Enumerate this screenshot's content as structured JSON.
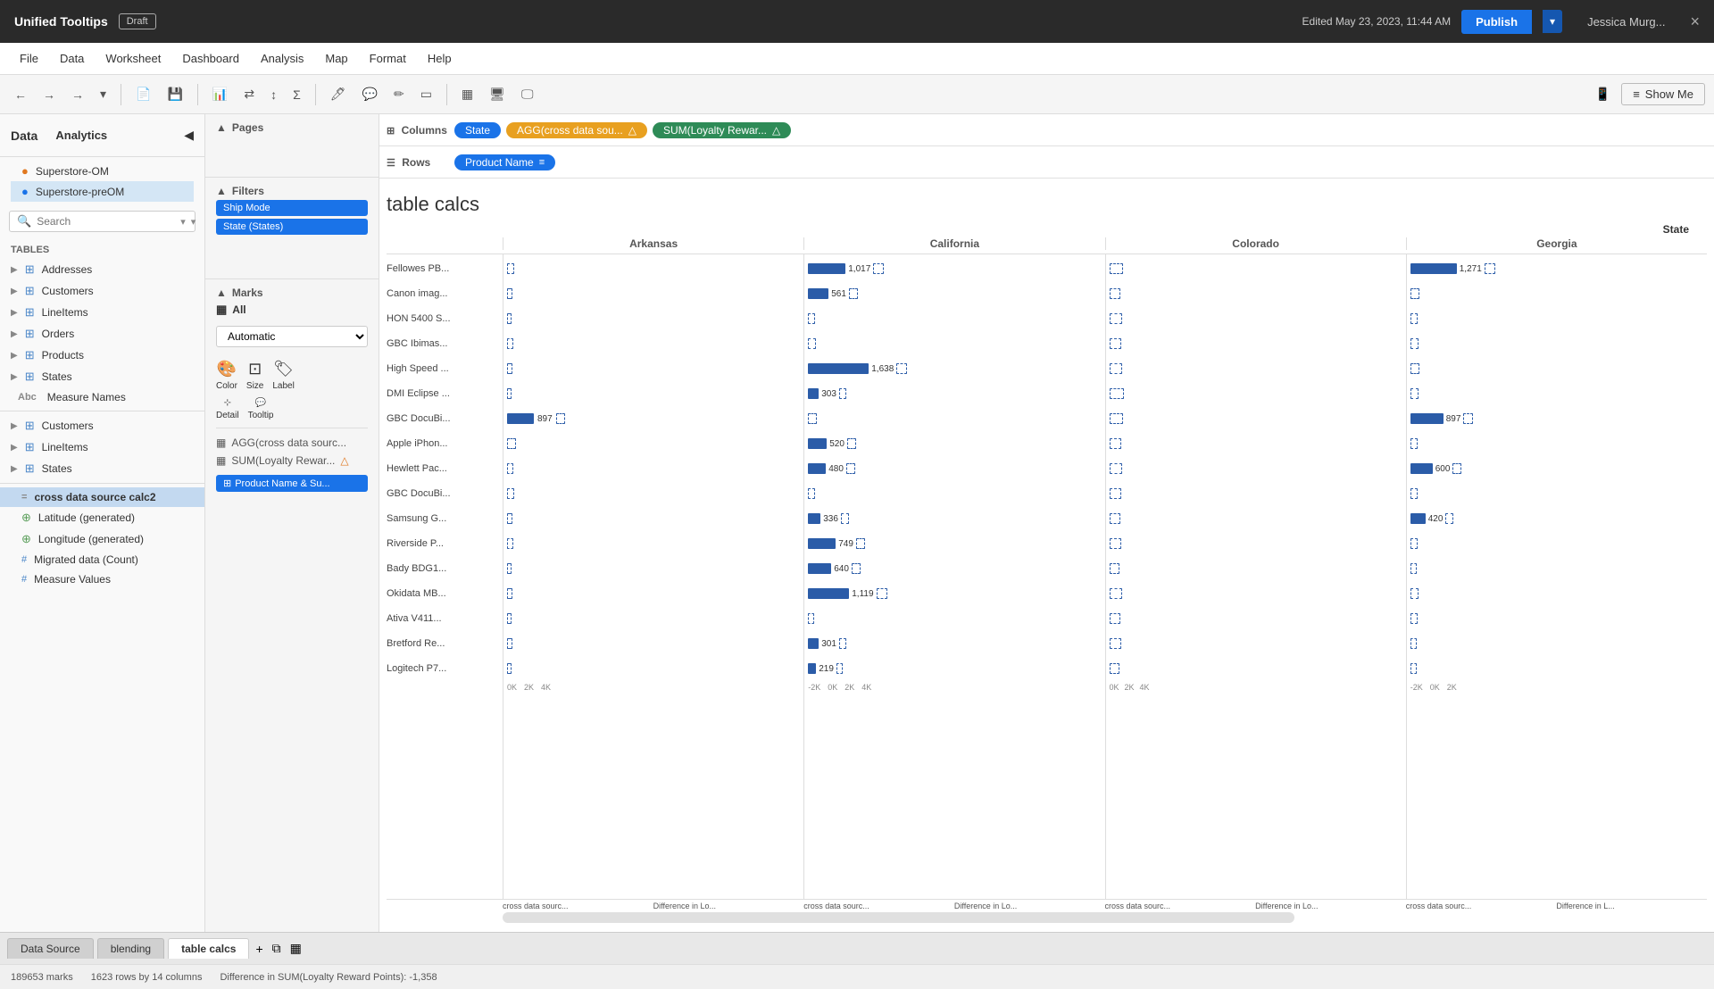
{
  "titlebar": {
    "title": "Unified Tooltips",
    "draft": "Draft",
    "edit_info": "Edited May 23, 2023, 11:44 AM",
    "publish": "Publish",
    "user": "Jessica Murg...",
    "close": "×"
  },
  "menubar": {
    "items": [
      "File",
      "Data",
      "Worksheet",
      "Dashboard",
      "Analysis",
      "Map",
      "Format",
      "Help"
    ]
  },
  "toolbar": {
    "back": "←",
    "forward": "→",
    "show_me": "Show Me"
  },
  "left_panel": {
    "data_title": "Data",
    "analytics_tab": "Analytics",
    "search_placeholder": "Search",
    "tables_title": "Tables",
    "tables": [
      {
        "name": "Addresses",
        "type": "table",
        "expanded": false
      },
      {
        "name": "Customers",
        "type": "table",
        "expanded": false
      },
      {
        "name": "LineItems",
        "type": "table",
        "expanded": false
      },
      {
        "name": "Orders",
        "type": "table",
        "expanded": false
      },
      {
        "name": "Products",
        "type": "table",
        "expanded": false
      },
      {
        "name": "States",
        "type": "table",
        "expanded": false
      },
      {
        "name": "Measure Names",
        "type": "abc",
        "expanded": false
      },
      {
        "name": "Customers",
        "type": "table2",
        "expanded": false
      },
      {
        "name": "LineItems",
        "type": "table2",
        "expanded": false
      },
      {
        "name": "States",
        "type": "table2",
        "expanded": false
      }
    ],
    "calcs": [
      {
        "name": "cross data source calc2",
        "type": "calc",
        "active": true
      },
      {
        "name": "Latitude (generated)",
        "type": "globe"
      },
      {
        "name": "Longitude (generated)",
        "type": "globe"
      },
      {
        "name": "Migrated data (Count)",
        "type": "hash"
      },
      {
        "name": "Measure Values",
        "type": "hash"
      }
    ],
    "datasources": [
      {
        "name": "Superstore-OM"
      },
      {
        "name": "Superstore-preOM"
      }
    ]
  },
  "middle_panel": {
    "pages_title": "Pages",
    "filters_title": "Filters",
    "filters": [
      "Ship Mode",
      "State (States)"
    ],
    "marks_title": "Marks",
    "marks_all": "All",
    "marks_type": "Automatic",
    "marks_items": [
      {
        "name": "AGG(cross data sourc...",
        "icon": "bar"
      },
      {
        "name": "SUM(Loyalty Rewar...",
        "icon": "bar"
      }
    ],
    "controls": [
      "Color",
      "Size",
      "Label",
      "Detail",
      "Tooltip"
    ],
    "product_chip": "Product Name & Su..."
  },
  "columns_shelf": {
    "label": "Columns",
    "pills": [
      {
        "text": "State",
        "color": "blue"
      },
      {
        "text": "AGG(cross data sou...",
        "color": "orange",
        "has_warning": true
      },
      {
        "text": "SUM(Loyalty Rewar...",
        "color": "green",
        "has_warning": true
      }
    ]
  },
  "rows_shelf": {
    "label": "Rows",
    "pills": [
      {
        "text": "Product Name",
        "color": "blue",
        "has_icon": true
      }
    ]
  },
  "chart": {
    "title": "table calcs",
    "state_label": "State",
    "states": [
      "Arkansas",
      "California",
      "Colorado",
      "Georgia"
    ],
    "products": [
      "Fellowes PB...",
      "Canon imag...",
      "HON 5400 S...",
      "GBC Ibimas...",
      "High Speed ...",
      "DMI Eclipse ...",
      "GBC DocuBi...",
      "Apple iPhon...",
      "Hewlett Pac...",
      "GBC DocuBi...",
      "Samsung G...",
      "Riverside P...",
      "Bady BDG1...",
      "Okidata MB...",
      "Ativa V411...",
      "Bretford Re...",
      "Logitech P7..."
    ],
    "bars": {
      "Arkansas": [
        {
          "val": "",
          "solid": 0,
          "dashed": 8
        },
        {
          "val": "",
          "solid": 0,
          "dashed": 6
        },
        {
          "val": "",
          "solid": 0,
          "dashed": 5
        },
        {
          "val": "",
          "solid": 0,
          "dashed": 7
        },
        {
          "val": "",
          "solid": 0,
          "dashed": 6
        },
        {
          "val": "",
          "solid": 0,
          "dashed": 5
        },
        {
          "val": "897",
          "solid": 30,
          "dashed": 10
        },
        {
          "val": "",
          "solid": 0,
          "dashed": 10
        },
        {
          "val": "",
          "solid": 0,
          "dashed": 7
        },
        {
          "val": "",
          "solid": 0,
          "dashed": 8
        },
        {
          "val": "",
          "solid": 0,
          "dashed": 6
        },
        {
          "val": "",
          "solid": 0,
          "dashed": 7
        },
        {
          "val": "",
          "solid": 0,
          "dashed": 5
        },
        {
          "val": "",
          "solid": 0,
          "dashed": 6
        },
        {
          "val": "",
          "solid": 0,
          "dashed": 5
        },
        {
          "val": "",
          "solid": 0,
          "dashed": 6
        },
        {
          "val": "",
          "solid": 0,
          "dashed": 5
        }
      ],
      "California": [
        {
          "val": "1,017",
          "solid": 42,
          "dashed": 12
        },
        {
          "val": "561",
          "solid": 23,
          "dashed": 10
        },
        {
          "val": "",
          "solid": 0,
          "dashed": 8
        },
        {
          "val": "",
          "solid": 0,
          "dashed": 9
        },
        {
          "val": "1,638",
          "solid": 68,
          "dashed": 12
        },
        {
          "val": "303",
          "solid": 12,
          "dashed": 8
        },
        {
          "val": "",
          "solid": 0,
          "dashed": 10
        },
        {
          "val": "520",
          "solid": 21,
          "dashed": 10
        },
        {
          "val": "480",
          "solid": 20,
          "dashed": 10
        },
        {
          "val": "",
          "solid": 0,
          "dashed": 8
        },
        {
          "val": "336",
          "solid": 14,
          "dashed": 9
        },
        {
          "val": "749",
          "solid": 31,
          "dashed": 10
        },
        {
          "val": "640",
          "solid": 26,
          "dashed": 10
        },
        {
          "val": "1,119",
          "solid": 46,
          "dashed": 12
        },
        {
          "val": "",
          "solid": 0,
          "dashed": 7
        },
        {
          "val": "301",
          "solid": 12,
          "dashed": 8
        },
        {
          "val": "219",
          "solid": 9,
          "dashed": 7
        }
      ],
      "Colorado": [
        {
          "val": "",
          "solid": 0,
          "dashed": 15
        },
        {
          "val": "",
          "solid": 0,
          "dashed": 12
        },
        {
          "val": "",
          "solid": 0,
          "dashed": 14
        },
        {
          "val": "",
          "solid": 0,
          "dashed": 13
        },
        {
          "val": "",
          "solid": 0,
          "dashed": 14
        },
        {
          "val": "",
          "solid": 0,
          "dashed": 16
        },
        {
          "val": "",
          "solid": 0,
          "dashed": 15
        },
        {
          "val": "",
          "solid": 0,
          "dashed": 13
        },
        {
          "val": "",
          "solid": 0,
          "dashed": 14
        },
        {
          "val": "",
          "solid": 0,
          "dashed": 13
        },
        {
          "val": "",
          "solid": 0,
          "dashed": 12
        },
        {
          "val": "",
          "solid": 0,
          "dashed": 13
        },
        {
          "val": "",
          "solid": 0,
          "dashed": 11
        },
        {
          "val": "",
          "solid": 0,
          "dashed": 14
        },
        {
          "val": "",
          "solid": 0,
          "dashed": 12
        },
        {
          "val": "",
          "solid": 0,
          "dashed": 13
        },
        {
          "val": "",
          "solid": 0,
          "dashed": 11
        }
      ],
      "Georgia": [
        {
          "val": "1,271",
          "solid": 52,
          "dashed": 12
        },
        {
          "val": "",
          "solid": 0,
          "dashed": 10
        },
        {
          "val": "",
          "solid": 0,
          "dashed": 8
        },
        {
          "val": "",
          "solid": 0,
          "dashed": 9
        },
        {
          "val": "",
          "solid": 0,
          "dashed": 10
        },
        {
          "val": "",
          "solid": 0,
          "dashed": 9
        },
        {
          "val": "897",
          "solid": 37,
          "dashed": 11
        },
        {
          "val": "",
          "solid": 0,
          "dashed": 8
        },
        {
          "val": "600",
          "solid": 25,
          "dashed": 10
        },
        {
          "val": "",
          "solid": 0,
          "dashed": 8
        },
        {
          "val": "420",
          "solid": 17,
          "dashed": 9
        },
        {
          "val": "",
          "solid": 0,
          "dashed": 8
        },
        {
          "val": "",
          "solid": 0,
          "dashed": 7
        },
        {
          "val": "",
          "solid": 0,
          "dashed": 9
        },
        {
          "val": "",
          "solid": 0,
          "dashed": 8
        },
        {
          "val": "",
          "solid": 0,
          "dashed": 7
        },
        {
          "val": "",
          "solid": 0,
          "dashed": 7
        }
      ]
    },
    "axis_labels": [
      "0K",
      "2K",
      "4K"
    ],
    "footer_items": [
      "cross data sourc...",
      "Difference in Lo...",
      "cross data sourc...",
      "Difference in Lo...",
      "cross data sourc...",
      "Difference in Lo...",
      "cross data sourc...",
      "Difference in L..."
    ]
  },
  "bottom_tabs": {
    "tabs": [
      "Data Source",
      "blending",
      "table calcs"
    ]
  },
  "statusbar": {
    "marks": "189653 marks",
    "rows_cols": "1623 rows by 14 columns",
    "diff": "Difference in SUM(Loyalty Reward Points): -1,358"
  }
}
